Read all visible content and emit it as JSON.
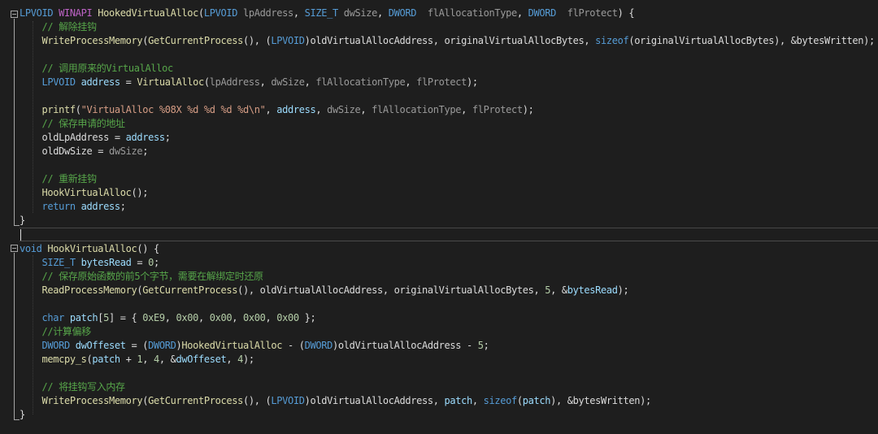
{
  "editor": {
    "colors": {
      "background": "#1e1e1e",
      "keyword": "#569cd6",
      "type": "#4ec9b0",
      "function": "#dcdcaa",
      "variable": "#9cdcfe",
      "string": "#d69d85",
      "number": "#b5cea8",
      "comment": "#57a64a",
      "macro": "#bd63c5",
      "plain": "#dcdcdc"
    },
    "lines": [
      [
        [
          "LPVOID ",
          "kw"
        ],
        [
          "WINAPI ",
          "mac"
        ],
        [
          "HookedVirtualAlloc",
          "fn"
        ],
        [
          "(",
          "pl"
        ],
        [
          "LPVOID ",
          "kw"
        ],
        [
          "lpAddress",
          "par"
        ],
        [
          ", ",
          "pl"
        ],
        [
          "SIZE_T ",
          "kw"
        ],
        [
          "dwSize",
          "par"
        ],
        [
          ", ",
          "pl"
        ],
        [
          "DWORD  ",
          "kw"
        ],
        [
          "flAllocationType",
          "par"
        ],
        [
          ", ",
          "pl"
        ],
        [
          "DWORD  ",
          "kw"
        ],
        [
          "flProtect",
          "par"
        ],
        [
          ") {",
          "pl"
        ]
      ],
      [
        [
          "    // 解除挂钩",
          "cm"
        ]
      ],
      [
        [
          "    ",
          "pl"
        ],
        [
          "WriteProcessMemory",
          "fn"
        ],
        [
          "(",
          "pl"
        ],
        [
          "GetCurrentProcess",
          "fn"
        ],
        [
          "(), (",
          "pl"
        ],
        [
          "LPVOID",
          "kw"
        ],
        [
          ")",
          "pl"
        ],
        [
          "oldVirtualAllocAddress",
          "pl"
        ],
        [
          ", ",
          "pl"
        ],
        [
          "originalVirtualAllocBytes",
          "pl"
        ],
        [
          ", ",
          "pl"
        ],
        [
          "sizeof",
          "kw"
        ],
        [
          "(",
          "pl"
        ],
        [
          "originalVirtualAllocBytes",
          "pl"
        ],
        [
          "), &",
          "pl"
        ],
        [
          "bytesWritten",
          "pl"
        ],
        [
          ");",
          "pl"
        ]
      ],
      [],
      [
        [
          "    // 调用原来的VirtualAlloc",
          "cm"
        ]
      ],
      [
        [
          "    ",
          "pl"
        ],
        [
          "LPVOID ",
          "kw"
        ],
        [
          "address",
          "var"
        ],
        [
          " = ",
          "pl"
        ],
        [
          "VirtualAlloc",
          "fn"
        ],
        [
          "(",
          "pl"
        ],
        [
          "lpAddress",
          "par"
        ],
        [
          ", ",
          "pl"
        ],
        [
          "dwSize",
          "par"
        ],
        [
          ", ",
          "pl"
        ],
        [
          "flAllocationType",
          "par"
        ],
        [
          ", ",
          "pl"
        ],
        [
          "flProtect",
          "par"
        ],
        [
          ");",
          "pl"
        ]
      ],
      [],
      [
        [
          "    ",
          "pl"
        ],
        [
          "printf",
          "fn"
        ],
        [
          "(",
          "pl"
        ],
        [
          "\"VirtualAlloc %08X %d %d %d %d\\n\"",
          "str"
        ],
        [
          ", ",
          "pl"
        ],
        [
          "address",
          "var"
        ],
        [
          ", ",
          "pl"
        ],
        [
          "dwSize",
          "par"
        ],
        [
          ", ",
          "pl"
        ],
        [
          "flAllocationType",
          "par"
        ],
        [
          ", ",
          "pl"
        ],
        [
          "flProtect",
          "par"
        ],
        [
          ");",
          "pl"
        ]
      ],
      [
        [
          "    // 保存申请的地址",
          "cm"
        ]
      ],
      [
        [
          "    ",
          "pl"
        ],
        [
          "oldLpAddress",
          "pl"
        ],
        [
          " = ",
          "pl"
        ],
        [
          "address",
          "var"
        ],
        [
          ";",
          "pl"
        ]
      ],
      [
        [
          "    ",
          "pl"
        ],
        [
          "oldDwSize",
          "pl"
        ],
        [
          " = ",
          "pl"
        ],
        [
          "dwSize",
          "par"
        ],
        [
          ";",
          "pl"
        ]
      ],
      [],
      [
        [
          "    // 重新挂钩",
          "cm"
        ]
      ],
      [
        [
          "    ",
          "pl"
        ],
        [
          "HookVirtualAlloc",
          "fn"
        ],
        [
          "();",
          "pl"
        ]
      ],
      [
        [
          "    ",
          "pl"
        ],
        [
          "return ",
          "kw"
        ],
        [
          "address",
          "var"
        ],
        [
          ";",
          "pl"
        ]
      ],
      [
        [
          "}",
          "pl"
        ]
      ],
      [],
      [
        [
          "void ",
          "kw"
        ],
        [
          "HookVirtualAlloc",
          "fn"
        ],
        [
          "() {",
          "pl"
        ]
      ],
      [
        [
          "    ",
          "pl"
        ],
        [
          "SIZE_T ",
          "kw"
        ],
        [
          "bytesRead",
          "var"
        ],
        [
          " = ",
          "pl"
        ],
        [
          "0",
          "num"
        ],
        [
          ";",
          "pl"
        ]
      ],
      [
        [
          "    // 保存原始函数的前5个字节，需要在解绑定时还原",
          "cm"
        ]
      ],
      [
        [
          "    ",
          "pl"
        ],
        [
          "ReadProcessMemory",
          "fn"
        ],
        [
          "(",
          "pl"
        ],
        [
          "GetCurrentProcess",
          "fn"
        ],
        [
          "(), ",
          "pl"
        ],
        [
          "oldVirtualAllocAddress",
          "pl"
        ],
        [
          ", ",
          "pl"
        ],
        [
          "originalVirtualAllocBytes",
          "pl"
        ],
        [
          ", ",
          "pl"
        ],
        [
          "5",
          "num"
        ],
        [
          ", &",
          "pl"
        ],
        [
          "bytesRead",
          "var"
        ],
        [
          ");",
          "pl"
        ]
      ],
      [],
      [
        [
          "    ",
          "pl"
        ],
        [
          "char ",
          "kw"
        ],
        [
          "patch",
          "var"
        ],
        [
          "[",
          "pl"
        ],
        [
          "5",
          "num"
        ],
        [
          "] = { ",
          "pl"
        ],
        [
          "0xE9",
          "num"
        ],
        [
          ", ",
          "pl"
        ],
        [
          "0x00",
          "num"
        ],
        [
          ", ",
          "pl"
        ],
        [
          "0x00",
          "num"
        ],
        [
          ", ",
          "pl"
        ],
        [
          "0x00",
          "num"
        ],
        [
          ", ",
          "pl"
        ],
        [
          "0x00",
          "num"
        ],
        [
          " };",
          "pl"
        ]
      ],
      [
        [
          "    //计算偏移",
          "cm"
        ]
      ],
      [
        [
          "    ",
          "pl"
        ],
        [
          "DWORD ",
          "kw"
        ],
        [
          "dwOffeset",
          "var"
        ],
        [
          " = (",
          "pl"
        ],
        [
          "DWORD",
          "kw"
        ],
        [
          ")",
          "pl"
        ],
        [
          "HookedVirtualAlloc",
          "fn"
        ],
        [
          " - (",
          "pl"
        ],
        [
          "DWORD",
          "kw"
        ],
        [
          ")",
          "pl"
        ],
        [
          "oldVirtualAllocAddress",
          "pl"
        ],
        [
          " - ",
          "pl"
        ],
        [
          "5",
          "num"
        ],
        [
          ";",
          "pl"
        ]
      ],
      [
        [
          "    ",
          "pl"
        ],
        [
          "memcpy_s",
          "fn"
        ],
        [
          "(",
          "pl"
        ],
        [
          "patch",
          "var"
        ],
        [
          " + ",
          "pl"
        ],
        [
          "1",
          "num"
        ],
        [
          ", ",
          "pl"
        ],
        [
          "4",
          "num"
        ],
        [
          ", &",
          "pl"
        ],
        [
          "dwOffeset",
          "var"
        ],
        [
          ", ",
          "pl"
        ],
        [
          "4",
          "num"
        ],
        [
          ");",
          "pl"
        ]
      ],
      [],
      [
        [
          "    // 将挂钩写入内存",
          "cm"
        ]
      ],
      [
        [
          "    ",
          "pl"
        ],
        [
          "WriteProcessMemory",
          "fn"
        ],
        [
          "(",
          "pl"
        ],
        [
          "GetCurrentProcess",
          "fn"
        ],
        [
          "(), (",
          "pl"
        ],
        [
          "LPVOID",
          "kw"
        ],
        [
          ")",
          "pl"
        ],
        [
          "oldVirtualAllocAddress",
          "pl"
        ],
        [
          ", ",
          "pl"
        ],
        [
          "patch",
          "var"
        ],
        [
          ", ",
          "pl"
        ],
        [
          "sizeof",
          "kw"
        ],
        [
          "(",
          "pl"
        ],
        [
          "patch",
          "var"
        ],
        [
          "), &",
          "pl"
        ],
        [
          "bytesWritten",
          "pl"
        ],
        [
          ");",
          "pl"
        ]
      ],
      [
        [
          "}",
          "pl"
        ]
      ]
    ]
  }
}
